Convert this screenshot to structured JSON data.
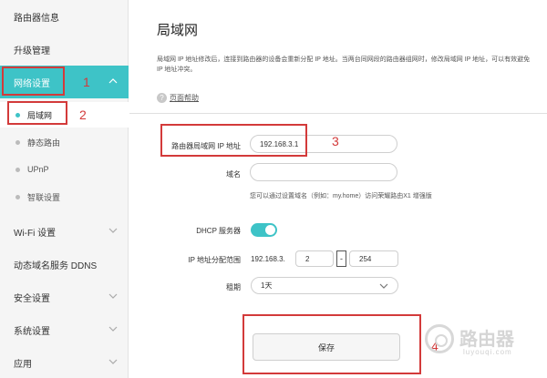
{
  "sidebar": {
    "items": [
      {
        "label": "路由器信息"
      },
      {
        "label": "升级管理"
      },
      {
        "label": "网络设置"
      },
      {
        "label": "Wi-Fi 设置"
      },
      {
        "label": "动态域名服务 DDNS"
      },
      {
        "label": "安全设置"
      },
      {
        "label": "系统设置"
      },
      {
        "label": "应用"
      }
    ],
    "sub_items": [
      {
        "label": "局域网"
      },
      {
        "label": "静态路由"
      },
      {
        "label": "UPnP"
      },
      {
        "label": "智联设置"
      }
    ]
  },
  "main": {
    "title": "局域网",
    "description": "局域网 IP 地址修改后，连接到路由器的设备会重新分配 IP 地址。当两台同网段的路由器组网时，修改局域网 IP 地址，可以有效避免 IP 地址冲突。",
    "help_icon": "?",
    "help_link": "页面帮助",
    "form": {
      "ip_label": "路由器局域网 IP 地址",
      "ip_value": "192.168.3.1",
      "domain_label": "域名",
      "domain_value": "",
      "domain_hint": "您可以通过设置域名（例如：my.home）访问荣耀路由X1 增强版",
      "dhcp_label": "DHCP 服务器",
      "dhcp_enabled": true,
      "range_label": "IP 地址分配范围",
      "range_prefix": "192.168.3.",
      "range_start": "2",
      "range_dash": "-",
      "range_end": "254",
      "lease_label": "租期",
      "lease_value": "1天",
      "save_label": "保存"
    }
  },
  "annotations": {
    "n1": "1",
    "n2": "2",
    "n3": "3",
    "n4": "4"
  },
  "watermark": {
    "name": "路由器",
    "url": "luyouqi.com"
  },
  "colors": {
    "accent": "#3ec3c7",
    "annotation": "#d33a3a"
  }
}
